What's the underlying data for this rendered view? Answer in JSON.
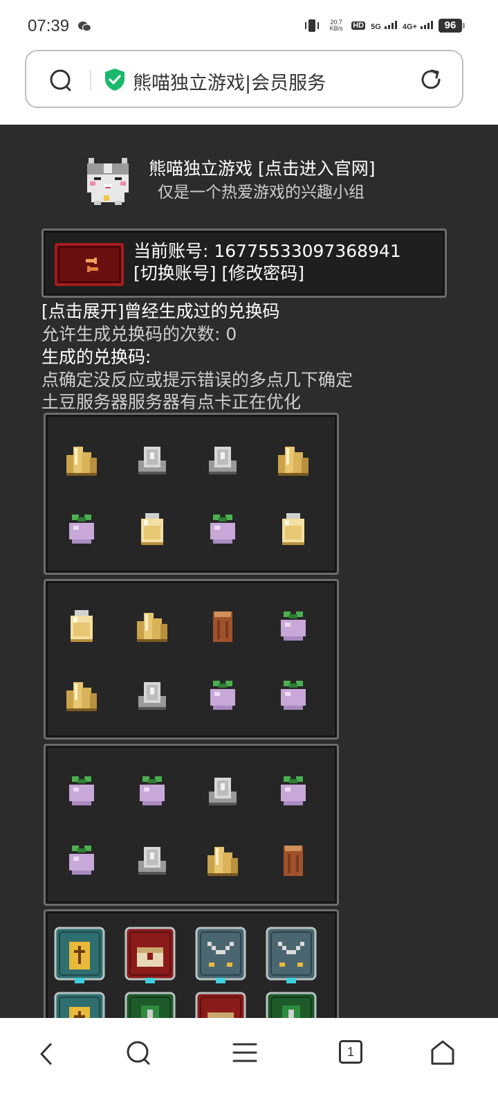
{
  "status_bar": {
    "time": "07:39",
    "network_speed_top": "20.7",
    "network_speed_unit": "KB/s",
    "hd_label": "HD",
    "sim1_type": "5G",
    "sim2_type": "4G+",
    "battery": "96"
  },
  "address_bar": {
    "page_title": "熊喵独立游戏|会员服务"
  },
  "site": {
    "title": "熊喵独立游戏 [点击进入官网]",
    "subtitle": "仅是一个热爱游戏的兴趣小组"
  },
  "account": {
    "current_label": "当前账号: 16775533097368941",
    "switch_account": "[切换账号]",
    "change_password": "[修改密码]"
  },
  "info": {
    "expand_history": "[点击展开]曾经生成过的兑换码",
    "allowed_count": "允许生成兑换码的次数: 0",
    "generated_label": "生成的兑换码:",
    "hint_retry": "点确定没反应或提示错误的多点几下确定",
    "hint_server": "土豆服务器服务器有点卡正在优化"
  },
  "item_panels": [
    {
      "items": [
        "gold-crystal-icon",
        "stone-ore-icon",
        "stone-ore-icon",
        "gold-crystal-icon",
        "turnip-icon",
        "jar-icon",
        "turnip-icon",
        "jar-icon"
      ]
    },
    {
      "items": [
        "jar-icon",
        "gold-crystal-icon",
        "wood-log-icon",
        "turnip-icon",
        "gold-crystal-icon",
        "stone-ore-icon",
        "turnip-icon",
        "turnip-icon"
      ]
    },
    {
      "items": [
        "turnip-icon",
        "turnip-icon",
        "stone-ore-icon",
        "turnip-icon",
        "turnip-icon",
        "stone-ore-icon",
        "gold-crystal-icon",
        "wood-log-icon"
      ]
    }
  ],
  "reward_panel": {
    "items": [
      "holy-book-card-icon",
      "treasure-chest-card-icon",
      "crossed-swords-card-icon",
      "crossed-swords-card-icon",
      "holy-book-card-icon",
      "green-shield-card-icon",
      "treasure-chest-card-icon",
      "green-shield-card-icon"
    ]
  },
  "bottom_nav": {
    "tab_count": "1"
  }
}
